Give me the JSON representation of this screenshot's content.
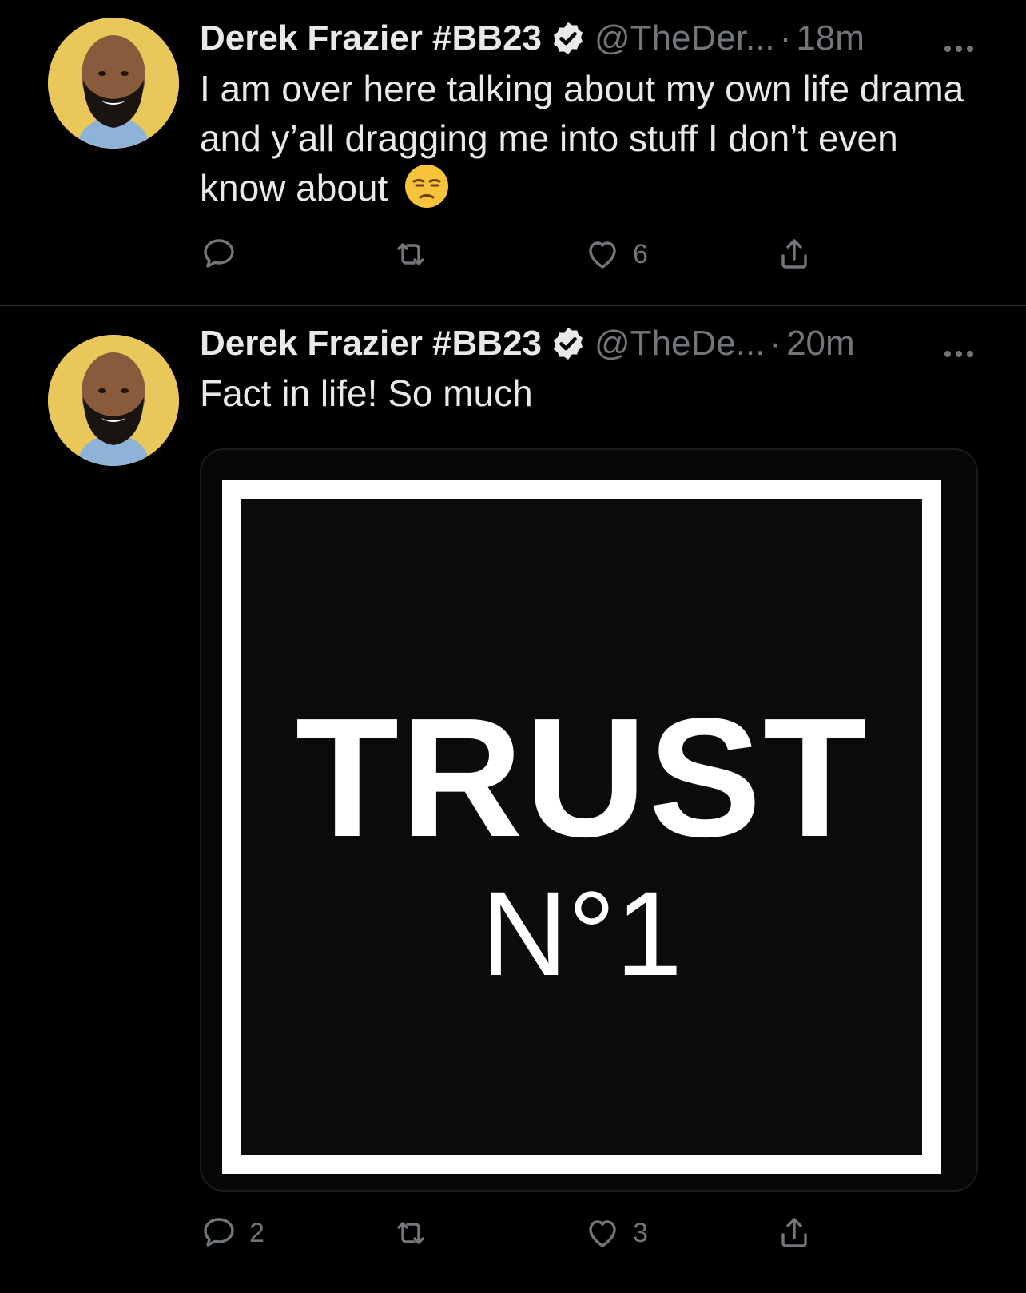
{
  "tweets": [
    {
      "author_name": "Derek Frazier #BB23",
      "handle": "@TheDer...",
      "separator": "·",
      "time": "18m",
      "text": "I am over here talking about my own life drama and y’all dragging me into stuff I don’t even know about",
      "emoji": "unamused-face-emoji",
      "reply_count": "",
      "retweet_count": "",
      "like_count": "6"
    },
    {
      "author_name": "Derek Frazier #BB23",
      "handle": "@TheDe...",
      "separator": "·",
      "time": "20m",
      "text": "Fact in life! So much",
      "media": {
        "line1": "TRUST",
        "line2": "N°1"
      },
      "reply_count": "2",
      "retweet_count": "",
      "like_count": "3"
    }
  ],
  "icons": [
    "verified-badge-icon",
    "more-icon",
    "reply-icon",
    "retweet-icon",
    "like-icon",
    "share-icon"
  ],
  "colors": {
    "background": "#000000",
    "text": "#e7e9ea",
    "muted": "#71767b",
    "divider": "#2f3336",
    "avatar_bg": "#e9c75a"
  }
}
